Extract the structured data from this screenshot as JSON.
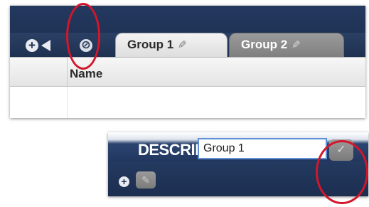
{
  "top_panel": {
    "controls": {
      "add_icon": "plus-circle-icon",
      "back_icon": "triangle-left-icon",
      "disable_icon": "prohibited-icon"
    },
    "tabs": [
      {
        "label": "Group 1",
        "glyph": "✎",
        "active": true
      },
      {
        "label": "Group 2",
        "glyph": "✎",
        "active": false
      }
    ],
    "grid": {
      "columns": [
        "Name"
      ]
    }
  },
  "bottom_panel": {
    "header_title": "DESCRIPTION",
    "header_ghost_text": "E",
    "add_glyph": "+",
    "edit_glyph": "✎",
    "name_input_value": "Group 1",
    "confirm_glyph": "✓"
  },
  "colors": {
    "navy": "#1f3152",
    "annotation_red": "#d3162a",
    "focus_blue": "#5f8fd6"
  }
}
